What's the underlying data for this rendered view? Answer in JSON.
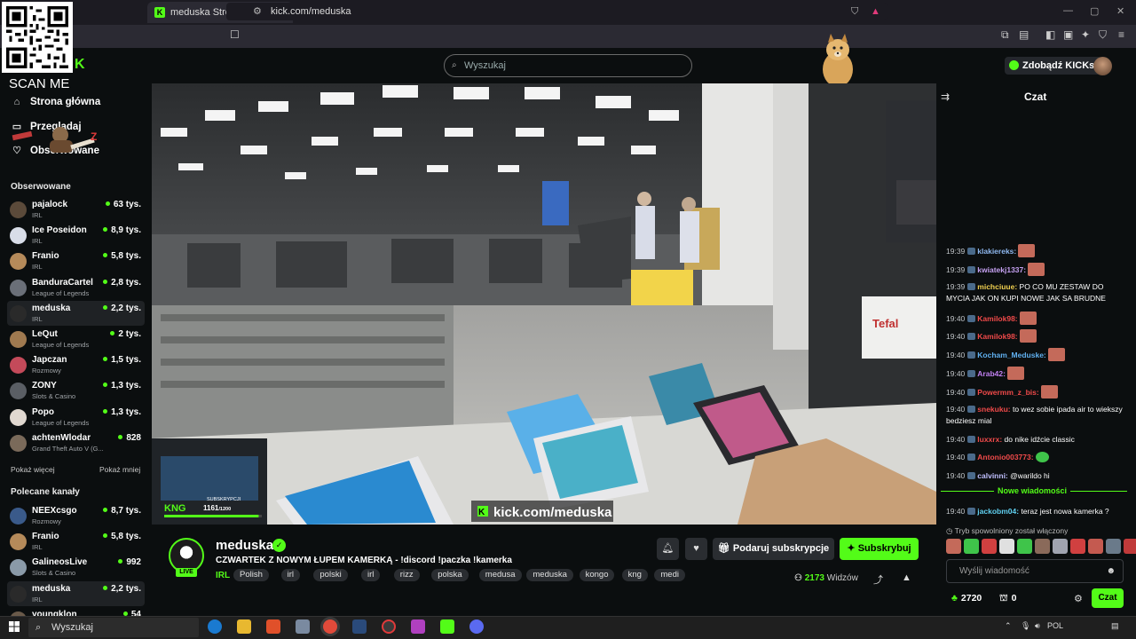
{
  "browser": {
    "tab_title": "meduska Stream - Watch Live o",
    "tab_close": "✕",
    "new_tab": "+",
    "url": "kick.com/meduska",
    "win_min": "—",
    "win_max": "▢",
    "win_close": "✕"
  },
  "overlay": {
    "scan_me": "SCAN ME"
  },
  "header": {
    "search_placeholder": "Wyszukaj",
    "get_kicks": "Zdobądź KICKs"
  },
  "sidebar": {
    "nav": [
      {
        "label": "Strona główna",
        "icon": "home-icon"
      },
      {
        "label": "Przeglądaj",
        "icon": "browse-icon"
      },
      {
        "label": "Obserwowane",
        "icon": "heart-icon"
      }
    ],
    "followed_title": "Obserwowane",
    "followed": [
      {
        "name": "pajalock",
        "category": "IRL",
        "viewers": "63 tys.",
        "color": "#5b4a3a"
      },
      {
        "name": "Ice Poseidon",
        "category": "IRL",
        "viewers": "8,9 tys.",
        "color": "#d8dde8"
      },
      {
        "name": "Franio",
        "category": "IRL",
        "viewers": "5,8 tys.",
        "color": "#b58a5a"
      },
      {
        "name": "BanduraCartel",
        "category": "League of Legends",
        "viewers": "2,8 tys.",
        "color": "#6a6f78"
      },
      {
        "name": "meduska",
        "category": "IRL",
        "viewers": "2,2 tys.",
        "color": "#2a2a2a"
      },
      {
        "name": "LeQut",
        "category": "League of Legends",
        "viewers": "2 tys.",
        "color": "#a07a50"
      },
      {
        "name": "Japczan",
        "category": "Rozmowy",
        "viewers": "1,5 tys.",
        "color": "#c44a5a"
      },
      {
        "name": "ZONY",
        "category": "Slots & Casino",
        "viewers": "1,3 tys.",
        "color": "#5a5e64"
      },
      {
        "name": "Popo",
        "category": "League of Legends",
        "viewers": "1,3 tys.",
        "color": "#e0d8d0"
      },
      {
        "name": "achtenWlodar",
        "category": "Grand Theft Auto V (G...",
        "viewers": "828",
        "color": "#7a6a5a"
      }
    ],
    "show_more": "Pokaż więcej",
    "show_less": "Pokaż mniej",
    "recommended_title": "Polecane kanały",
    "recommended": [
      {
        "name": "NEEXcsgo",
        "category": "Rozmowy",
        "viewers": "8,7 tys.",
        "color": "#3a5a8a"
      },
      {
        "name": "Franio",
        "category": "IRL",
        "viewers": "5,8 tys.",
        "color": "#b58a5a"
      },
      {
        "name": "GalineosLive",
        "category": "Slots & Casino",
        "viewers": "992",
        "color": "#8a9aa8"
      },
      {
        "name": "meduska",
        "category": "IRL",
        "viewers": "2,2 tys.",
        "color": "#2a2a2a"
      },
      {
        "name": "youngklon",
        "category": "",
        "viewers": "54",
        "color": "#6a5a4a"
      }
    ]
  },
  "video": {
    "overlay_url": "kick.com/meduska",
    "sub_label": "SUBSKRYPCJI",
    "sub_count": "1161",
    "sub_goal": "/1200",
    "sub_progress": 0.9675
  },
  "stream": {
    "name": "meduska",
    "live": "LIVE",
    "title": "CZWARTEK Z NOWYM ŁUPEM KAMERKĄ - !discord !paczka !kamerka",
    "category": "IRL",
    "tags": [
      "Polish",
      "irl",
      "polski",
      "irl",
      "rizz",
      "polska",
      "medusa",
      "meduska",
      "kongo",
      "kng",
      "medi"
    ],
    "gift_label": "Podaruj subskrypcje",
    "subscribe_label": "Subskrybuj",
    "viewers": "2173",
    "viewers_label": "Widzów"
  },
  "chat": {
    "title": "Czat",
    "messages": [
      {
        "time": "19:39",
        "user": "klakiereks:",
        "color": "#8fb8f0",
        "text": "",
        "emote": "e"
      },
      {
        "time": "19:39",
        "user": "kwiatekj1337:",
        "color": "#c4a0f0",
        "text": "",
        "emote": "e"
      },
      {
        "time": "19:39",
        "user": "michciuue:",
        "color": "#f0d050",
        "text": "PO CO MU ZESTAW DO MYCIA JAK ON KUPI NOWE JAK SA BRUDNE",
        "emote": ""
      },
      {
        "time": "19:40",
        "user": "Kamilok98:",
        "color": "#f04a4a",
        "text": "",
        "emote": "e"
      },
      {
        "time": "19:40",
        "user": "Kamilok98:",
        "color": "#f04a4a",
        "text": "",
        "emote": "e"
      },
      {
        "time": "19:40",
        "user": "Kocham_Meduske:",
        "color": "#60b0f0",
        "text": "",
        "emote": "e"
      },
      {
        "time": "19:40",
        "user": "Arab42:",
        "color": "#c080f0",
        "text": "",
        "emote": "e"
      },
      {
        "time": "19:40",
        "user": "Powermm_z_bis:",
        "color": "#f04a4a",
        "text": "",
        "emote": "e"
      },
      {
        "time": "19:40",
        "user": "snekuku:",
        "color": "#f04a4a",
        "text": "to wez sobie ipada air to wiekszy bedziesz mial",
        "emote": ""
      },
      {
        "time": "19:40",
        "user": "luxxrx:",
        "color": "#f04a4a",
        "text": "do nike idźcie classic",
        "emote": ""
      },
      {
        "time": "19:40",
        "user": "Antonio003773:",
        "color": "#f04a4a",
        "text": "",
        "emote": "g"
      },
      {
        "time": "19:40",
        "user": "calvinni:",
        "color": "#c0c0ff",
        "text": "@warildo hi",
        "emote": ""
      }
    ],
    "new_messages": "Nowe wiadomości",
    "after_new": {
      "time": "19:40",
      "user": "jackobm04:",
      "color": "#60d0f0",
      "text": "teraz jest nowa kamerka ?"
    },
    "slow_mode": "Tryb spowolniony został włączony",
    "input_placeholder": "Wyślij wiadomość",
    "kicks": "2720",
    "points": "0",
    "send_label": "Czat"
  },
  "taskbar": {
    "search": "Wyszukaj",
    "lang": "POL"
  }
}
